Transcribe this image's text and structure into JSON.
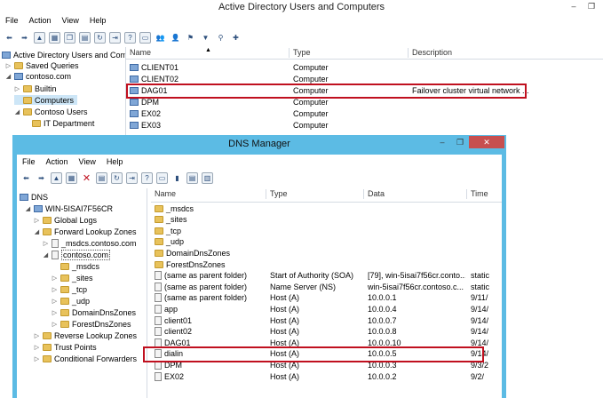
{
  "ad": {
    "title": "Active Directory Users and Computers",
    "menu": [
      "File",
      "Action",
      "View",
      "Help"
    ],
    "tree": [
      {
        "label": "Active Directory Users and Com",
        "twisty": ""
      },
      {
        "label": "Saved Queries",
        "twisty": "▷"
      },
      {
        "label": "contoso.com",
        "twisty": "◢"
      },
      {
        "label": "Builtin",
        "twisty": "▷"
      },
      {
        "label": "Computers",
        "twisty": ""
      },
      {
        "label": "Contoso Users",
        "twisty": "◢"
      },
      {
        "label": "IT Department",
        "twisty": ""
      }
    ],
    "columns": [
      "Name",
      "Type",
      "Description"
    ],
    "rows": [
      {
        "name": "CLIENT01",
        "type": "Computer",
        "desc": ""
      },
      {
        "name": "CLIENT02",
        "type": "Computer",
        "desc": ""
      },
      {
        "name": "DAG01",
        "type": "Computer",
        "desc": "Failover cluster virtual network ..."
      },
      {
        "name": "DPM",
        "type": "Computer",
        "desc": ""
      },
      {
        "name": "EX02",
        "type": "Computer",
        "desc": ""
      },
      {
        "name": "EX03",
        "type": "Computer",
        "desc": ""
      }
    ]
  },
  "dns": {
    "title": "DNS Manager",
    "menu": [
      "File",
      "Action",
      "View",
      "Help"
    ],
    "tree": [
      {
        "label": "DNS",
        "twisty": ""
      },
      {
        "label": "WIN-5ISAI7F56CR",
        "twisty": "◢"
      },
      {
        "label": "Global Logs",
        "twisty": "▷"
      },
      {
        "label": "Forward Lookup Zones",
        "twisty": "◢"
      },
      {
        "label": "_msdcs.contoso.com",
        "twisty": "▷"
      },
      {
        "label": "contoso.com",
        "twisty": "◢"
      },
      {
        "label": "_msdcs",
        "twisty": ""
      },
      {
        "label": "_sites",
        "twisty": "▷"
      },
      {
        "label": "_tcp",
        "twisty": "▷"
      },
      {
        "label": "_udp",
        "twisty": "▷"
      },
      {
        "label": "DomainDnsZones",
        "twisty": "▷"
      },
      {
        "label": "ForestDnsZones",
        "twisty": "▷"
      },
      {
        "label": "Reverse Lookup Zones",
        "twisty": "▷"
      },
      {
        "label": "Trust Points",
        "twisty": "▷"
      },
      {
        "label": "Conditional Forwarders",
        "twisty": "▷"
      }
    ],
    "columns": [
      "Name",
      "Type",
      "Data",
      "Time"
    ],
    "rows": [
      {
        "name": "_msdcs",
        "type": "",
        "data": "",
        "time": "",
        "icon": "folder"
      },
      {
        "name": "_sites",
        "type": "",
        "data": "",
        "time": "",
        "icon": "folder"
      },
      {
        "name": "_tcp",
        "type": "",
        "data": "",
        "time": "",
        "icon": "folder"
      },
      {
        "name": "_udp",
        "type": "",
        "data": "",
        "time": "",
        "icon": "folder"
      },
      {
        "name": "DomainDnsZones",
        "type": "",
        "data": "",
        "time": "",
        "icon": "folder"
      },
      {
        "name": "ForestDnsZones",
        "type": "",
        "data": "",
        "time": "",
        "icon": "folder"
      },
      {
        "name": "(same as parent folder)",
        "type": "Start of Authority (SOA)",
        "data": "[79], win-5isai7f56cr.conto...",
        "time": "static",
        "icon": "doc"
      },
      {
        "name": "(same as parent folder)",
        "type": "Name Server (NS)",
        "data": "win-5isai7f56cr.contoso.c...",
        "time": "static",
        "icon": "doc"
      },
      {
        "name": "(same as parent folder)",
        "type": "Host (A)",
        "data": "10.0.0.1",
        "time": "9/11/",
        "icon": "doc"
      },
      {
        "name": "app",
        "type": "Host (A)",
        "data": "10.0.0.4",
        "time": "9/14/",
        "icon": "doc"
      },
      {
        "name": "client01",
        "type": "Host (A)",
        "data": "10.0.0.7",
        "time": "9/14/",
        "icon": "doc"
      },
      {
        "name": "client02",
        "type": "Host (A)",
        "data": "10.0.0.8",
        "time": "9/14/",
        "icon": "doc"
      },
      {
        "name": "DAG01",
        "type": "Host (A)",
        "data": "10.0.0.10",
        "time": "9/14/",
        "icon": "doc"
      },
      {
        "name": "dialin",
        "type": "Host (A)",
        "data": "10.0.0.5",
        "time": "9/14/",
        "icon": "doc"
      },
      {
        "name": "DPM",
        "type": "Host (A)",
        "data": "10.0.0.3",
        "time": "9/3/2",
        "icon": "doc"
      },
      {
        "name": "EX02",
        "type": "Host (A)",
        "data": "10.0.0.2",
        "time": "9/2/",
        "icon": "doc"
      }
    ]
  }
}
